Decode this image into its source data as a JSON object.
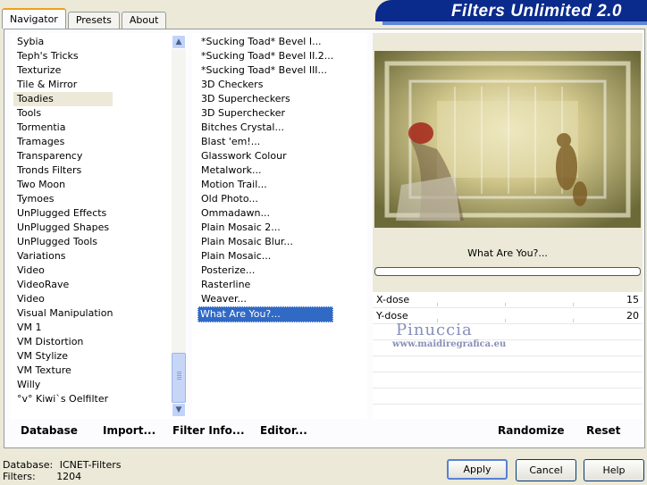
{
  "tabs": [
    "Navigator",
    "Presets",
    "About"
  ],
  "banner_title": "Filters Unlimited 2.0",
  "categories": [
    "Sybia",
    "Teph's Tricks",
    "Texturize",
    "Tile & Mirror",
    "Toadies",
    "Tools",
    "Tormentia",
    "Tramages",
    "Transparency",
    "Tronds Filters",
    "Two Moon",
    "Tymoes",
    "UnPlugged Effects",
    "UnPlugged Shapes",
    "UnPlugged Tools",
    "Variations",
    "Video",
    "VideoRave",
    "Video",
    "Visual Manipulation",
    "VM 1",
    "VM Distortion",
    "VM Stylize",
    "VM Texture",
    "Willy",
    "°v° Kiwi`s Oelfilter"
  ],
  "selected_category": "Toadies",
  "filters": [
    "*Sucking Toad* Bevel I...",
    "*Sucking Toad* Bevel II.2...",
    "*Sucking Toad* Bevel III...",
    "3D Checkers",
    "3D Supercheckers",
    "3D Superchecker",
    "Bitches Crystal...",
    "Blast 'em!...",
    "Glasswork Colour",
    "Metalwork...",
    "Motion Trail...",
    "Old Photo...",
    "Ommadawn...",
    "Plain Mosaic 2...",
    "Plain Mosaic Blur...",
    "Plain Mosaic...",
    "Posterize...",
    "Rasterline",
    "Weaver...",
    "What Are You?..."
  ],
  "selected_filter": "What Are You?...",
  "preview": {
    "filter_name": "What Are You?..."
  },
  "params": [
    {
      "name": "X-dose",
      "value": "15"
    },
    {
      "name": "Y-dose",
      "value": "20"
    }
  ],
  "watermark": {
    "name": "Pinuccia",
    "url": "www.maidiregrafica.eu"
  },
  "toolbar": {
    "database": "Database",
    "import": "Import...",
    "filter_info": "Filter Info...",
    "editor": "Editor...",
    "randomize": "Randomize",
    "reset": "Reset"
  },
  "footer": {
    "database_label": "Database:",
    "database_value": "ICNET-Filters",
    "filters_label": "Filters:",
    "filters_value": "1204"
  },
  "buttons": {
    "apply": "Apply",
    "cancel": "Cancel",
    "help": "Help"
  }
}
